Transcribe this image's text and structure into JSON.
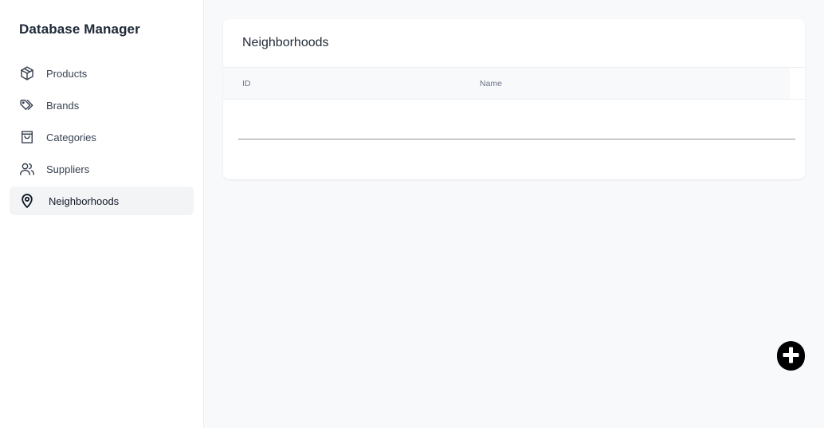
{
  "app": {
    "title": "Database Manager"
  },
  "sidebar": {
    "items": [
      {
        "label": "Products",
        "icon": "package-icon",
        "active": false
      },
      {
        "label": "Brands",
        "icon": "tags-icon",
        "active": false
      },
      {
        "label": "Categories",
        "icon": "shopping-bag-icon",
        "active": false
      },
      {
        "label": "Suppliers",
        "icon": "users-icon",
        "active": false
      },
      {
        "label": "Neighborhoods",
        "icon": "map-pin-icon",
        "active": true
      }
    ]
  },
  "main": {
    "title": "Neighborhoods",
    "table": {
      "columns": [
        "ID",
        "Name"
      ],
      "rows": []
    },
    "fab": {
      "icon": "plus-circle-icon"
    }
  },
  "colors": {
    "background": "#f8f9fb",
    "sidebar": "#ffffff",
    "active_item": "#f3f4f6",
    "fab": "#000000"
  }
}
